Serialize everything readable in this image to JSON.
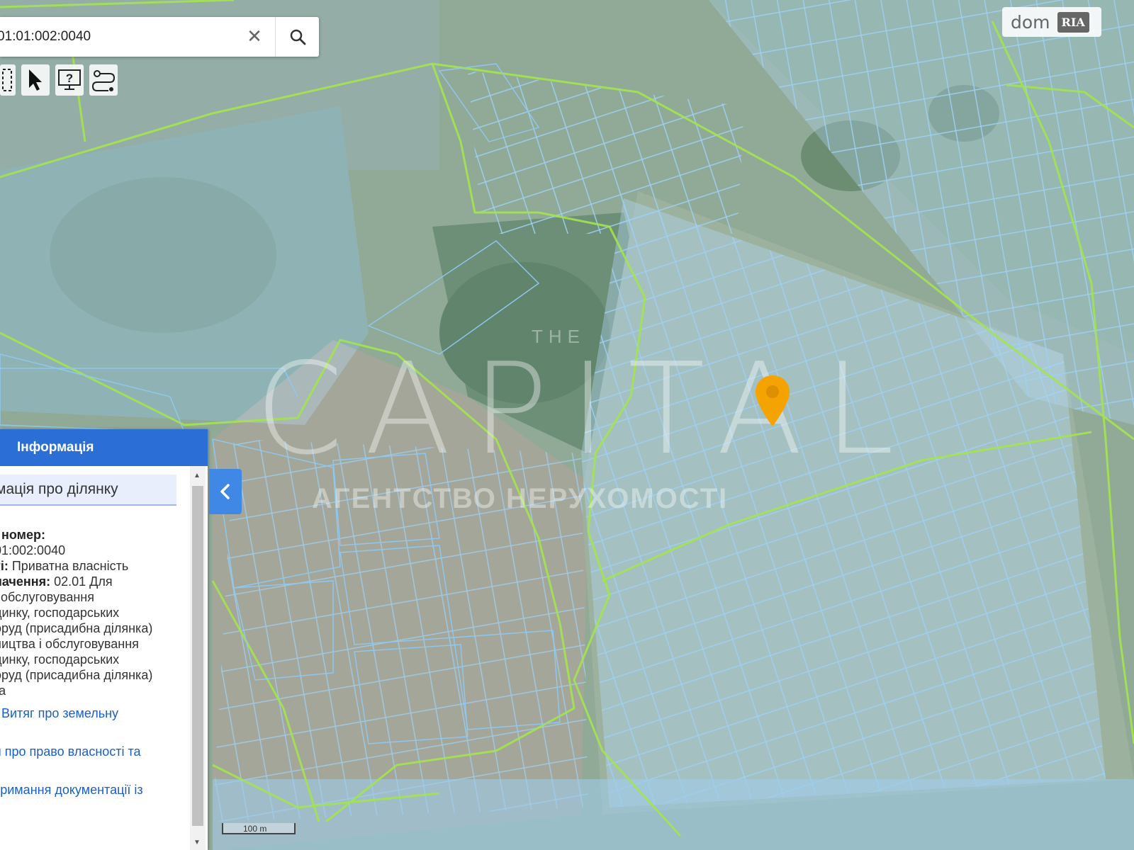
{
  "search": {
    "value": "01:01:002:0040",
    "clear_icon": "close-icon",
    "search_icon": "search-icon"
  },
  "toolbar": {
    "tools": [
      "measure-icon",
      "pointer-icon",
      "help-monitor-icon",
      "route-icon"
    ]
  },
  "brand": {
    "dom": "dom",
    "ria": "RIA"
  },
  "watermark": {
    "top": "THE",
    "main": "CAPITAL",
    "sub": "АГЕНТСТВО НЕРУХОМОСТІ"
  },
  "panel": {
    "header": "Інформація",
    "subheader": "мація про ділянку",
    "cadastral_label": "і номер:",
    "cadastral_value": "01:002:0040",
    "ownership_label": "ті:",
    "ownership_value": " Приватна власність",
    "purpose_label": "начення:",
    "purpose_value": " 02.01 Для",
    "purpose_lines": [
      "і обслуговування",
      "динку, господарських",
      "оруд (присадибна ділянка)",
      "ництва і обслуговування",
      "динку, господарських",
      "оруд (присадибна ділянка)"
    ],
    "area_line": "га",
    "link_extract": "Витяг про земельну",
    "link_ownership": "я про право власності та",
    "link_docs": "тримання документації із"
  },
  "scale": {
    "label": "100 m"
  },
  "colors": {
    "panel_header": "#2b6fd6",
    "parcel_fill": "#a9d2f3",
    "boundary_green": "#a4e44f",
    "pin": "#f5a300"
  }
}
